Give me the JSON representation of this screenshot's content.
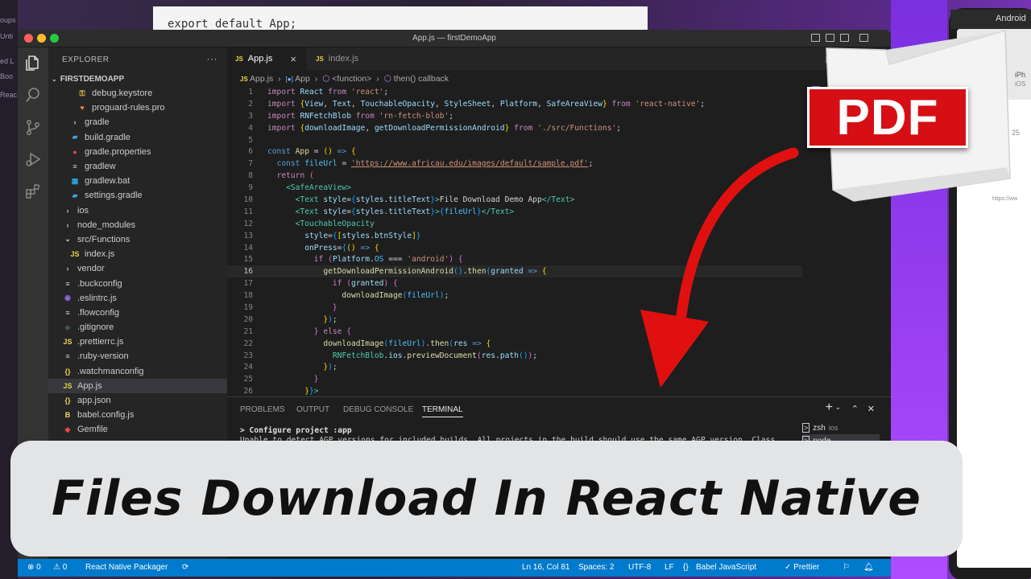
{
  "background": {
    "left_strip_texts": [
      "oups",
      "Unti",
      "ed L",
      "Boo",
      "Reac"
    ],
    "top_doc_code": "export default App;",
    "phone": {
      "bar_label": "Android",
      "device_name": "iPh",
      "device_sub": "iOS",
      "number": "25",
      "url_fragment": "https://ww"
    }
  },
  "window": {
    "title": "App.js — firstDemoApp"
  },
  "activity_bar": [
    "files-icon",
    "search-icon",
    "source-control-icon",
    "run-debug-icon",
    "extensions-icon"
  ],
  "sidebar": {
    "header": "EXPLORER",
    "more": "···",
    "project": "FIRSTDEMOAPP",
    "items": [
      {
        "label": "debug.keystore",
        "icon": "key",
        "indent": 3,
        "color": "#e8c34a"
      },
      {
        "label": "proguard-rules.pro",
        "icon": "heart",
        "indent": 3,
        "color": "#e8824a"
      },
      {
        "label": "gradle",
        "icon": ">",
        "indent": 2,
        "color": "#cccccc"
      },
      {
        "label": "build.gradle",
        "icon": "elephant",
        "indent": 2,
        "color": "#3fa3d6"
      },
      {
        "label": "gradle.properties",
        "icon": "dot",
        "indent": 2,
        "color": "#e04a4a"
      },
      {
        "label": "gradlew",
        "icon": "lines",
        "indent": 2,
        "color": "#cccccc"
      },
      {
        "label": "gradlew.bat",
        "icon": "win",
        "indent": 2,
        "color": "#2aa5e0"
      },
      {
        "label": "settings.gradle",
        "icon": "elephant",
        "indent": 2,
        "color": "#3fa3d6"
      },
      {
        "label": "ios",
        "icon": ">",
        "indent": 1,
        "color": "#cccccc"
      },
      {
        "label": "node_modules",
        "icon": ">",
        "indent": 1,
        "color": "#cccccc"
      },
      {
        "label": "src/Functions",
        "icon": "v",
        "indent": 1,
        "color": "#cccccc"
      },
      {
        "label": "index.js",
        "icon": "JS",
        "indent": 2,
        "color": "#e8d44d"
      },
      {
        "label": "vendor",
        "icon": ">",
        "indent": 1,
        "color": "#cccccc"
      },
      {
        "label": ".buckconfig",
        "icon": "lines",
        "indent": 1,
        "color": "#cccccc"
      },
      {
        "label": ".eslintrc.js",
        "icon": "circle",
        "indent": 1,
        "color": "#8a6bd6"
      },
      {
        "label": ".flowconfig",
        "icon": "lines",
        "indent": 1,
        "color": "#cccccc"
      },
      {
        "label": ".gitignore",
        "icon": "diamond",
        "indent": 1,
        "color": "#41535b"
      },
      {
        "label": ".prettierrc.js",
        "icon": "JS",
        "indent": 1,
        "color": "#e8d44d"
      },
      {
        "label": ".ruby-version",
        "icon": "lines",
        "indent": 1,
        "color": "#cccccc"
      },
      {
        "label": ".watchmanconfig",
        "icon": "{}",
        "indent": 1,
        "color": "#e8d44d"
      },
      {
        "label": "App.js",
        "icon": "JS",
        "indent": 1,
        "color": "#e8d44d",
        "active": true
      },
      {
        "label": "app.json",
        "icon": "{}",
        "indent": 1,
        "color": "#e8d44d"
      },
      {
        "label": "babel.config.js",
        "icon": "B",
        "indent": 1,
        "color": "#f5da55"
      },
      {
        "label": "Gemfile",
        "icon": "gem",
        "indent": 1,
        "color": "#e04a4a"
      }
    ]
  },
  "tabs": [
    {
      "label": "App.js",
      "icon": "JS",
      "active": true,
      "close": "×"
    },
    {
      "label": "index.js",
      "icon": "JS",
      "active": false
    }
  ],
  "breadcrumb": {
    "file": "App.js",
    "sep": "›",
    "c1": "App",
    "c2": "<function>",
    "c3": "then() callback"
  },
  "code_lines": [
    {
      "n": "1",
      "t": [
        [
          "kw",
          "import "
        ],
        [
          "var",
          "React "
        ],
        [
          "kw",
          "from "
        ],
        [
          "str",
          "'react'"
        ],
        [
          "pun",
          ";"
        ]
      ]
    },
    {
      "n": "2",
      "t": [
        [
          "kw",
          "import "
        ],
        [
          "br1",
          "{"
        ],
        [
          "var",
          "View"
        ],
        [
          "pun",
          ", "
        ],
        [
          "var",
          "Text"
        ],
        [
          "pun",
          ", "
        ],
        [
          "var",
          "TouchableOpacity"
        ],
        [
          "pun",
          ", "
        ],
        [
          "var",
          "StyleSheet"
        ],
        [
          "pun",
          ", "
        ],
        [
          "var",
          "Platform"
        ],
        [
          "pun",
          ", "
        ],
        [
          "var",
          "SafeAreaView"
        ],
        [
          "br1",
          "} "
        ],
        [
          "kw",
          "from "
        ],
        [
          "str",
          "'react-native'"
        ],
        [
          "pun",
          ";"
        ]
      ]
    },
    {
      "n": "3",
      "t": [
        [
          "kw",
          "import "
        ],
        [
          "var",
          "RNFetchBlob "
        ],
        [
          "kw",
          "from "
        ],
        [
          "str",
          "'rn-fetch-blob'"
        ],
        [
          "pun",
          ";"
        ]
      ]
    },
    {
      "n": "4",
      "t": [
        [
          "kw",
          "import "
        ],
        [
          "br1",
          "{"
        ],
        [
          "var",
          "downloadImage"
        ],
        [
          "pun",
          ", "
        ],
        [
          "var",
          "getDownloadPermissionAndroid"
        ],
        [
          "br1",
          "} "
        ],
        [
          "kw",
          "from "
        ],
        [
          "str",
          "'./src/Functions'"
        ],
        [
          "pun",
          ";"
        ]
      ]
    },
    {
      "n": "5",
      "t": []
    },
    {
      "n": "6",
      "t": [
        [
          "kb",
          "const "
        ],
        [
          "fn",
          "App "
        ],
        [
          "pun",
          "= "
        ],
        [
          "br1",
          "() "
        ],
        [
          "kb",
          "=> "
        ],
        [
          "br1",
          "{"
        ]
      ]
    },
    {
      "n": "7",
      "t": [
        [
          "pun",
          "  "
        ],
        [
          "kb",
          "const "
        ],
        [
          "con",
          "fileUrl "
        ],
        [
          "pun",
          "= "
        ],
        [
          "url",
          "'https://www.africau.edu/images/default/sample.pdf'"
        ],
        [
          "pun",
          ";"
        ]
      ]
    },
    {
      "n": "8",
      "t": [
        [
          "pun",
          "  "
        ],
        [
          "kw",
          "return "
        ],
        [
          "br2",
          "("
        ]
      ]
    },
    {
      "n": "9",
      "t": [
        [
          "pun",
          "    "
        ],
        [
          "tag",
          "<SafeAreaView>"
        ]
      ]
    },
    {
      "n": "10",
      "t": [
        [
          "pun",
          "      "
        ],
        [
          "tag",
          "<Text "
        ],
        [
          "var",
          "style"
        ],
        [
          "pun",
          "="
        ],
        [
          "br3",
          "{"
        ],
        [
          "var",
          "styles.titleText"
        ],
        [
          "br3",
          "}"
        ],
        [
          "tag",
          ">"
        ],
        [
          "pun",
          "File Download Demo App"
        ],
        [
          "tag",
          "</Text>"
        ]
      ]
    },
    {
      "n": "11",
      "t": [
        [
          "pun",
          "      "
        ],
        [
          "tag",
          "<Text "
        ],
        [
          "var",
          "style"
        ],
        [
          "pun",
          "="
        ],
        [
          "br3",
          "{"
        ],
        [
          "var",
          "styles.titleText"
        ],
        [
          "br3",
          "}"
        ],
        [
          "tag",
          ">"
        ],
        [
          "br3",
          "{"
        ],
        [
          "con",
          "fileUrl"
        ],
        [
          "br3",
          "}"
        ],
        [
          "tag",
          "</Text>"
        ]
      ]
    },
    {
      "n": "12",
      "t": [
        [
          "pun",
          "      "
        ],
        [
          "tag",
          "<TouchableOpacity"
        ]
      ]
    },
    {
      "n": "13",
      "t": [
        [
          "pun",
          "        "
        ],
        [
          "var",
          "style"
        ],
        [
          "pun",
          "="
        ],
        [
          "br3",
          "{"
        ],
        [
          "br1",
          "["
        ],
        [
          "var",
          "styles.btnStyle"
        ],
        [
          "br1",
          "]"
        ],
        [
          "br3",
          "}"
        ]
      ]
    },
    {
      "n": "14",
      "t": [
        [
          "pun",
          "        "
        ],
        [
          "var",
          "onPress"
        ],
        [
          "pun",
          "="
        ],
        [
          "br3",
          "{"
        ],
        [
          "br1",
          "() "
        ],
        [
          "kb",
          "=> "
        ],
        [
          "br1",
          "{"
        ]
      ]
    },
    {
      "n": "15",
      "t": [
        [
          "pun",
          "          "
        ],
        [
          "kw",
          "if "
        ],
        [
          "br2",
          "("
        ],
        [
          "var",
          "Platform"
        ],
        [
          "pun",
          "."
        ],
        [
          "con",
          "OS "
        ],
        [
          "pun",
          "=== "
        ],
        [
          "str",
          "'android'"
        ],
        [
          "br2",
          ") "
        ],
        [
          "br2",
          "{"
        ]
      ]
    },
    {
      "n": "16",
      "t": [
        [
          "pun",
          "            "
        ],
        [
          "fn",
          "getDownloadPermissionAndroid"
        ],
        [
          "br3",
          "()"
        ],
        [
          "pun",
          "."
        ],
        [
          "fn",
          "then"
        ],
        [
          "br3",
          "("
        ],
        [
          "var",
          "granted "
        ],
        [
          "kb",
          "=> "
        ],
        [
          "br1",
          "{"
        ]
      ],
      "current": true
    },
    {
      "n": "17",
      "t": [
        [
          "pun",
          "              "
        ],
        [
          "kw",
          "if "
        ],
        [
          "br2",
          "("
        ],
        [
          "var",
          "granted"
        ],
        [
          "br2",
          ") "
        ],
        [
          "br2",
          "{"
        ]
      ]
    },
    {
      "n": "18",
      "t": [
        [
          "pun",
          "                "
        ],
        [
          "fn",
          "downloadImage"
        ],
        [
          "br3",
          "("
        ],
        [
          "con",
          "fileUrl"
        ],
        [
          "br3",
          ")"
        ],
        [
          "pun",
          ";"
        ]
      ]
    },
    {
      "n": "19",
      "t": [
        [
          "pun",
          "              "
        ],
        [
          "br2",
          "}"
        ]
      ]
    },
    {
      "n": "20",
      "t": [
        [
          "pun",
          "            "
        ],
        [
          "br1",
          "}"
        ],
        [
          "br3",
          ")"
        ],
        [
          "pun",
          ";"
        ]
      ]
    },
    {
      "n": "21",
      "t": [
        [
          "pun",
          "          "
        ],
        [
          "br2",
          "} "
        ],
        [
          "kw",
          "else "
        ],
        [
          "br2",
          "{"
        ]
      ]
    },
    {
      "n": "22",
      "t": [
        [
          "pun",
          "            "
        ],
        [
          "fn",
          "downloadImage"
        ],
        [
          "br3",
          "("
        ],
        [
          "con",
          "fileUrl"
        ],
        [
          "br3",
          ")"
        ],
        [
          "pun",
          "."
        ],
        [
          "fn",
          "then"
        ],
        [
          "br3",
          "("
        ],
        [
          "var",
          "res "
        ],
        [
          "kb",
          "=> "
        ],
        [
          "br1",
          "{"
        ]
      ]
    },
    {
      "n": "23",
      "t": [
        [
          "pun",
          "              "
        ],
        [
          "cls",
          "RNFetchBlob"
        ],
        [
          "pun",
          "."
        ],
        [
          "var",
          "ios"
        ],
        [
          "pun",
          "."
        ],
        [
          "fn",
          "previewDocument"
        ],
        [
          "br2",
          "("
        ],
        [
          "var",
          "res"
        ],
        [
          "pun",
          "."
        ],
        [
          "var",
          "path"
        ],
        [
          "br3",
          "()"
        ],
        [
          "br2",
          ")"
        ],
        [
          "pun",
          ";"
        ]
      ]
    },
    {
      "n": "24",
      "t": [
        [
          "pun",
          "            "
        ],
        [
          "br1",
          "}"
        ],
        [
          "br3",
          ")"
        ],
        [
          "pun",
          ";"
        ]
      ]
    },
    {
      "n": "25",
      "t": [
        [
          "pun",
          "          "
        ],
        [
          "br2",
          "}"
        ]
      ]
    },
    {
      "n": "26",
      "t": [
        [
          "pun",
          "        "
        ],
        [
          "br1",
          "}"
        ],
        [
          "br3",
          "}"
        ],
        [
          "tag",
          ">"
        ]
      ]
    }
  ],
  "panel": {
    "tabs": [
      "PROBLEMS",
      "OUTPUT",
      "DEBUG CONSOLE",
      "TERMINAL"
    ],
    "active_tab": "TERMINAL",
    "term_line1": "> Configure project :app",
    "term_line2": "Unable to detect AGP versions for included builds. All projects in the build should use the same AGP version. Class",
    "terminals": [
      {
        "label": "zsh",
        "sub": "ios"
      },
      {
        "label": "node",
        "sub": ""
      }
    ],
    "actions": [
      "+",
      "⌄",
      "⌃",
      "✕"
    ]
  },
  "statusbar": {
    "errors": "⊗ 0",
    "warnings": "⚠ 0",
    "packager": "React Native Packager",
    "position": "Ln 16, Col 81",
    "spaces": "Spaces: 2",
    "encoding": "UTF-8",
    "eol": "LF",
    "language": "Babel JavaScript",
    "prettier": "✓ Prettier"
  },
  "overlay": {
    "pdf_label": "PDF",
    "arrow_color": "#e01010",
    "title": "Files Download In React Native"
  },
  "colors": {
    "accent": "#007acc",
    "pdf_red": "#d60f14",
    "banner_bg": "#e3e4e5"
  }
}
